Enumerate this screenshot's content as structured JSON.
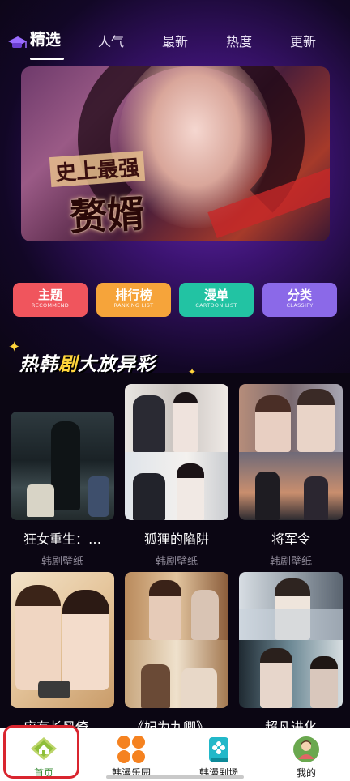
{
  "tabs": [
    {
      "label": "精选",
      "active": true
    },
    {
      "label": "人气",
      "active": false
    },
    {
      "label": "最新",
      "active": false
    },
    {
      "label": "热度",
      "active": false
    },
    {
      "label": "更新",
      "active": false
    }
  ],
  "banner": {
    "line1": "史上最强",
    "line2": "赘婿"
  },
  "categories": [
    {
      "label": "主题",
      "sub": "RECOMMEND",
      "color": "#f0555d"
    },
    {
      "label": "排行榜",
      "sub": "RANKING LIST",
      "color": "#f6a43a"
    },
    {
      "label": "漫单",
      "sub": "CARTOON LIST",
      "color": "#22c3a3"
    },
    {
      "label": "分类",
      "sub": "CLASSIFY",
      "color": "#8b69e8"
    }
  ],
  "section": {
    "title_pre": "热韩",
    "title_hl": "剧",
    "title_post": "大放异彩"
  },
  "cards": [
    {
      "title": "狂女重生：…",
      "sub": "韩剧壁纸"
    },
    {
      "title": "狐狸的陷阱",
      "sub": "韩剧壁纸"
    },
    {
      "title": "将军令",
      "sub": "韩剧壁纸"
    },
    {
      "title": "应有长风倚…",
      "sub": ""
    },
    {
      "title": "《妃为九卿》…",
      "sub": ""
    },
    {
      "title": "超凡进化",
      "sub": ""
    }
  ],
  "nav": [
    {
      "label": "首页",
      "icon": "home-icon",
      "active": true
    },
    {
      "label": "韩漫乐园",
      "icon": "grid-icon",
      "active": false
    },
    {
      "label": "韩漫剧场",
      "icon": "flower-book-icon",
      "active": false
    },
    {
      "label": "我的",
      "icon": "profile-icon",
      "active": false
    }
  ],
  "colors": {
    "accent_green": "#3d8f3a",
    "highlight": "#d9252f",
    "nav_orange": "#f58220",
    "nav_teal": "#22b8c9"
  }
}
